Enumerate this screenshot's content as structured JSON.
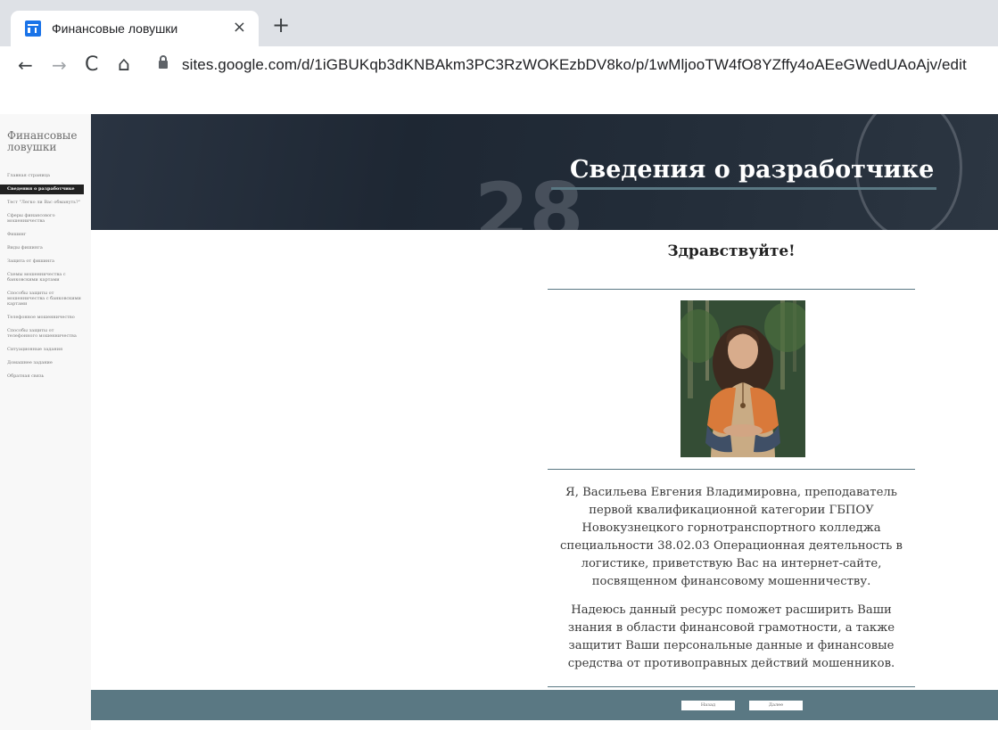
{
  "browser": {
    "tab_title": "Финансовые ловушки",
    "tab_close": "×",
    "new_tab": "+",
    "back": "←",
    "forward": "→",
    "reload": "C",
    "home": "⌂",
    "url": "sites.google.com/d/1iGBUKqb3dKNBAkm3PC3RzWOKEzbDV8ko/p/1wMljooTW4fO8YZffy4oAEeGWedUAoAjv/edit"
  },
  "sidebar": {
    "site_title": "Финансовые ловушки",
    "items": [
      {
        "label": "Главная страница",
        "active": false
      },
      {
        "label": "Сведения о разработчике",
        "active": true
      },
      {
        "label": "Тест \"Легко ли Вас обмануть?\"",
        "active": false
      },
      {
        "label": "Сферы финансового мошенничества",
        "active": false
      },
      {
        "label": "Фишинг",
        "active": false
      },
      {
        "label": "Виды фишинга",
        "active": false
      },
      {
        "label": "Защита от фишинга",
        "active": false
      },
      {
        "label": "Схемы мошенничества с банковскими картами",
        "active": false
      },
      {
        "label": "Способы защиты от мошенничества с банковскими картами",
        "active": false
      },
      {
        "label": "Телефонное мошенничество",
        "active": false
      },
      {
        "label": "Способы защиты от телефонного мошенничества",
        "active": false
      },
      {
        "label": "Ситуационные задания",
        "active": false
      },
      {
        "label": "Домашнее задание",
        "active": false
      },
      {
        "label": "Обратная связь",
        "active": false
      }
    ]
  },
  "banner": {
    "title": "Сведения о разработчике",
    "deco_text": "28"
  },
  "content": {
    "greeting": "Здравствуйте!",
    "bio_paragraph_1": "Я, Васильева Евгения Владимировна, преподаватель первой квалификационной категории ГБПОУ Новокузнецкого горнотранспортного колледжа специальности 38.02.03 Операционная деятельность в логистике, приветствую Вас на интернет-сайте, посвященном финансовому мошенничеству.",
    "bio_paragraph_2": "Надеюсь данный ресурс поможет расширить Ваши знания в области финансовой грамотности, а также защитит Ваши персональные данные и финансовые средства от противоправных действий мошенников."
  },
  "footer": {
    "prev_label": "Назад",
    "next_label": "Далее"
  },
  "colors": {
    "accent": "#5a7883",
    "banner_dark": "#1e2733",
    "active_nav": "#212121"
  }
}
